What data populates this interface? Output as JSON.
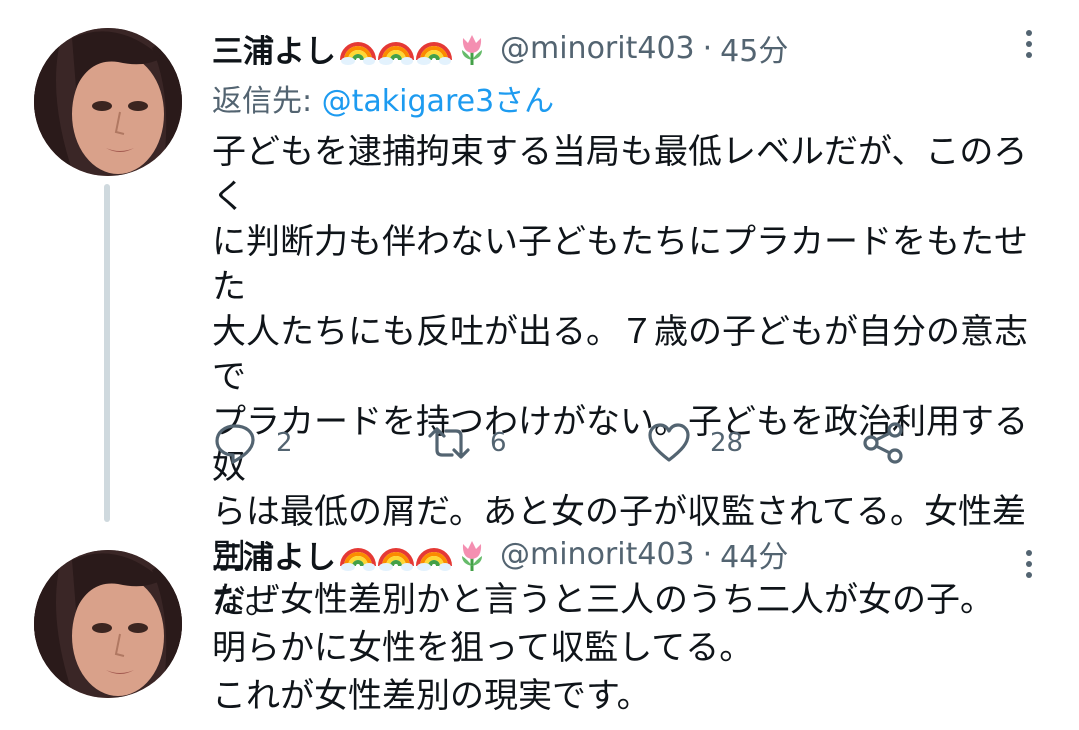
{
  "tweets": [
    {
      "display_name": "三浦よし",
      "name_emojis": [
        "rainbow-emoji",
        "rainbow-emoji",
        "rainbow-emoji",
        "tulip-emoji"
      ],
      "handle": "@minorit403",
      "separator": "·",
      "time": "45分",
      "reply_prefix": "返信先: ",
      "reply_handle": "@takigare3",
      "reply_suffix": "さん",
      "text": "子どもを逮捕拘束する当局も最低レベルだが、このろく\nに判断力も伴わない子どもたちにプラカードをもたせた\n大人たちにも反吐が出る。７歳の子どもが自分の意志で\nプラカードを持つわけがない。子どもを政治利用する奴\nらは最低の屑だ。あと女の子が収監されてる。女性差別\nだ。",
      "actions": {
        "reply_icon": "comment-icon",
        "reply_count": "2",
        "retweet_icon": "retweet-icon",
        "retweet_count": "6",
        "like_icon": "heart-icon",
        "like_count": "28",
        "share_icon": "share-icon"
      }
    },
    {
      "display_name": "三浦よし",
      "name_emojis": [
        "rainbow-emoji",
        "rainbow-emoji",
        "rainbow-emoji",
        "tulip-emoji"
      ],
      "handle": "@minorit403",
      "separator": "·",
      "time": "44分",
      "text": "なぜ女性差別かと言うと三人のうち二人が女の子。\n明らかに女性を狙って収監してる。\nこれが女性差別の現実です。"
    }
  ],
  "colors": {
    "text": "#0f1419",
    "secondary": "#536471",
    "link": "#1d9bf0",
    "thread_line": "#cfd9de",
    "background": "#ffffff"
  }
}
